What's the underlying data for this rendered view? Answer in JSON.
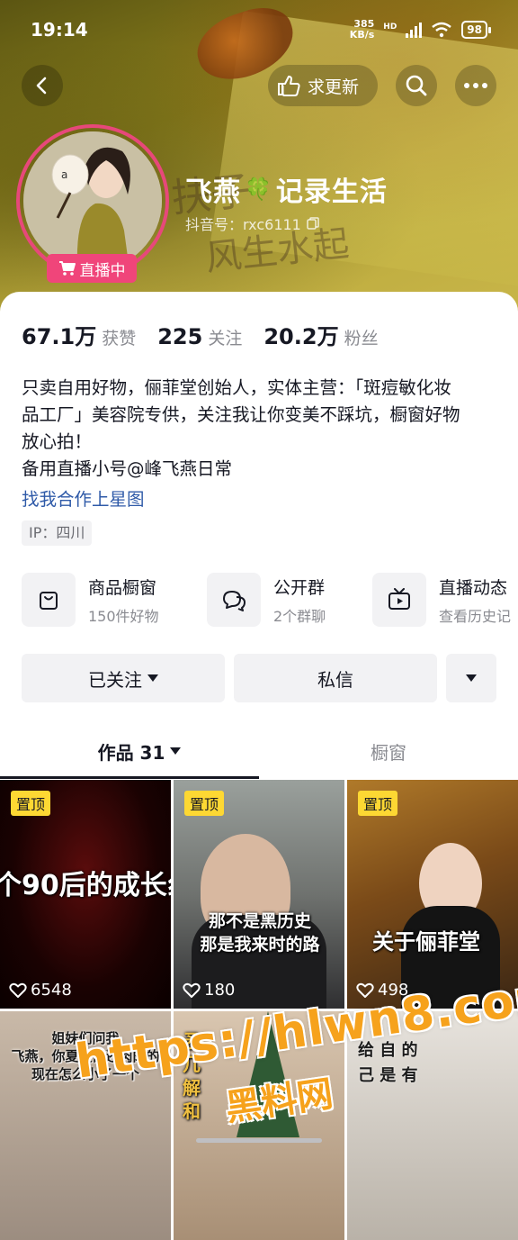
{
  "status_bar": {
    "time": "19:14",
    "net_speed_value": "385",
    "net_speed_unit": "KB/s",
    "network": "HD",
    "battery": "98"
  },
  "nav": {
    "back_icon": "chevron-left-icon",
    "request_update_label": "求更新",
    "search_icon": "search-icon",
    "more_icon": "more-icon"
  },
  "profile": {
    "live_badge": "直播中",
    "nickname_part1": "飞燕",
    "nickname_emoji": "🍀",
    "nickname_part2": "记录生活",
    "douyin_id": "抖音号：rxc6111",
    "banner_scribble_1": "扶子",
    "banner_scribble_2": "风生水起"
  },
  "stats": [
    {
      "value": "67.1万",
      "label": "获赞"
    },
    {
      "value": "225",
      "label": "关注"
    },
    {
      "value": "20.2万",
      "label": "粉丝"
    }
  ],
  "bio": {
    "line1": "只卖自用好物，俪菲堂创始人，实体主营：「斑痘敏化妆",
    "line2": "品工厂」美容院专供，关注我让你变美不踩坑，橱窗好物",
    "line3": "放心拍！",
    "line4": "备用直播小号@峰飞燕日常",
    "link": "找我合作上星图",
    "ip": "IP：四川"
  },
  "features": [
    {
      "title": "商品橱窗",
      "subtitle": "150件好物",
      "icon": "bag-icon"
    },
    {
      "title": "公开群",
      "subtitle": "2个群聊",
      "icon": "chat-bubbles-icon"
    },
    {
      "title": "直播动态",
      "subtitle": "查看历史记",
      "icon": "tv-play-icon"
    }
  ],
  "actions": {
    "followed_label": "已关注",
    "message_label": "私信"
  },
  "tabs": {
    "works_label": "作品 31",
    "showcase_label": "橱窗"
  },
  "videos": [
    {
      "pinned": "置顶",
      "caption": "个90后的成长纟",
      "likes": "6548"
    },
    {
      "pinned": "置顶",
      "caption_1": "那不是黑历史",
      "caption_2": "那是我来时的路",
      "likes": "180"
    },
    {
      "pinned": "置顶",
      "caption": "关于俪菲堂",
      "likes": "498"
    },
    {
      "caption_1": "姐妹们问我",
      "caption_2": "飞燕，你夏天都还肉肉的",
      "caption_3": "现在怎么小了一个"
    },
    {
      "caption": "矛 几 解 和"
    },
    {
      "caption": "给 自 的 己 是 有"
    }
  ],
  "watermark": {
    "url": "https://hlwn8.com",
    "name": "黑料网"
  }
}
